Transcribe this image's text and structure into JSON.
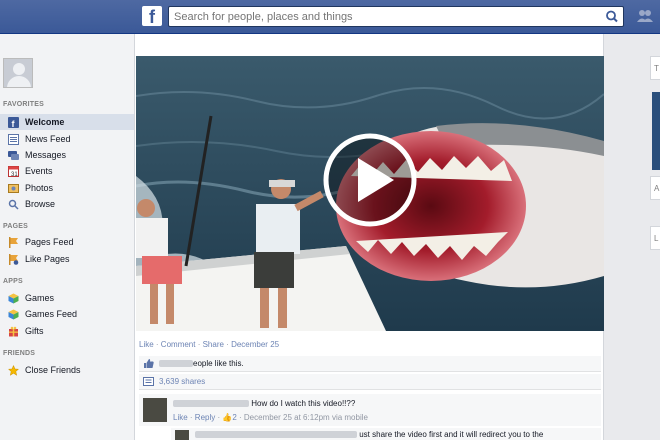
{
  "topbar": {
    "logo": "f",
    "search_placeholder": "Search for people, places and things"
  },
  "sidebar": {
    "sections": [
      {
        "title": "FAVORITES",
        "items": [
          {
            "label": "Welcome",
            "icon": "welcome-f-icon",
            "selected": true
          },
          {
            "label": "News Feed",
            "icon": "news-feed-icon"
          },
          {
            "label": "Messages",
            "icon": "messages-icon"
          },
          {
            "label": "Events",
            "icon": "events-calendar-icon"
          },
          {
            "label": "Photos",
            "icon": "photos-icon"
          },
          {
            "label": "Browse",
            "icon": "search-browse-icon"
          }
        ]
      },
      {
        "title": "PAGES",
        "items": [
          {
            "label": "Pages Feed",
            "icon": "pages-feed-icon"
          },
          {
            "label": "Like Pages",
            "icon": "like-pages-icon"
          }
        ]
      },
      {
        "title": "APPS",
        "items": [
          {
            "label": "Games",
            "icon": "games-cube-icon"
          },
          {
            "label": "Games Feed",
            "icon": "games-feed-icon"
          },
          {
            "label": "Gifts",
            "icon": "gift-icon"
          }
        ]
      },
      {
        "title": "FRIENDS",
        "items": [
          {
            "label": "Close Friends",
            "icon": "star-icon"
          }
        ]
      }
    ]
  },
  "post": {
    "actions": {
      "like": "Like",
      "comment": "Comment",
      "share": "Share",
      "sep": " · ",
      "date": "December 25"
    },
    "likes_text": "eople like this.",
    "shares_text": "3,639 shares",
    "comment": {
      "text": "How do I watch this video!!??",
      "like": "Like",
      "reply": "Reply",
      "like_count": "2",
      "meta": " · December 25 at 6:12pm via mobile"
    },
    "reply_text": "ust share the video first and it will redirect you to the"
  },
  "rightcol": {
    "box1": "T",
    "box2": "A",
    "box3": "L"
  },
  "colors": {
    "brand": "#3b5998",
    "link": "#6d84b4",
    "selected_bg": "#d8dfea"
  }
}
